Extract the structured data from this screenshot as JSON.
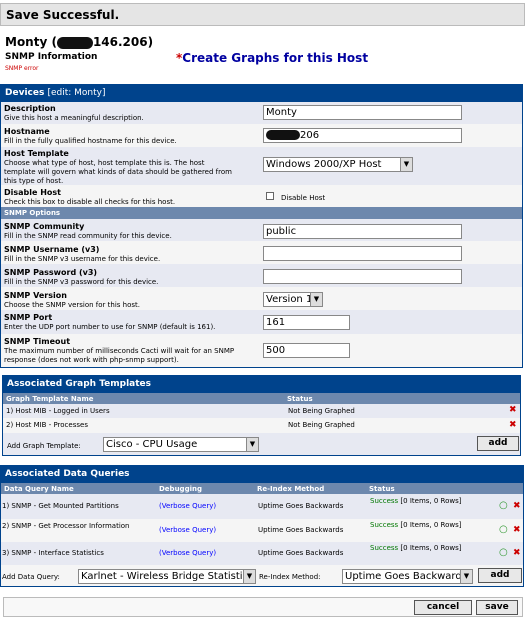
{
  "banner": {
    "message": "Save Successful."
  },
  "host": {
    "title_prefix": "Monty (",
    "title_suffix": "146.206)",
    "snmp_info": "SNMP Information",
    "snmp_error": "SNMP error"
  },
  "create_graphs": {
    "asterisk": "*",
    "label": "Create Graphs for this Host"
  },
  "devices": {
    "header": "Devices",
    "edit": "[edit: Monty]",
    "description": {
      "title": "Description",
      "help": "Give this host a meaningful description.",
      "value": "Monty"
    },
    "hostname": {
      "title": "Hostname",
      "help": "Fill in the fully qualified hostname for this device.",
      "value": "206"
    },
    "template": {
      "title": "Host Template",
      "help": "Choose what type of host, host template this is. The host template will govern what kinds of data should be gathered from this type of host.",
      "value": "Windows 2000/XP Host"
    },
    "disable": {
      "title": "Disable Host",
      "help": "Check this box to disable all checks for this host.",
      "label": "Disable Host"
    },
    "snmp_options": "SNMP Options",
    "community": {
      "title": "SNMP Community",
      "help": "Fill in the SNMP read community for this device.",
      "value": "public"
    },
    "username": {
      "title": "SNMP Username (v3)",
      "help": "Fill in the SNMP v3 username for this device.",
      "value": ""
    },
    "password": {
      "title": "SNMP Password (v3)",
      "help": "Fill in the SNMP v3 password for this device.",
      "value": ""
    },
    "version": {
      "title": "SNMP Version",
      "help": "Choose the SNMP version for this host.",
      "value": "Version 1"
    },
    "port": {
      "title": "SNMP Port",
      "help": "Enter the UDP port number to use for SNMP (default is 161).",
      "value": "161"
    },
    "timeout": {
      "title": "SNMP Timeout",
      "help": "The maximum number of milliseconds Cacti will wait for an SNMP response (does not work with php-snmp support).",
      "value": "500"
    }
  },
  "graph_templates": {
    "header": "Associated Graph Templates",
    "col_name": "Graph Template Name",
    "col_status": "Status",
    "rows": [
      {
        "name": "1) Host MIB - Logged in Users",
        "status": "Not Being Graphed"
      },
      {
        "name": "2) Host MIB - Processes",
        "status": "Not Being Graphed"
      }
    ],
    "add_label": "Add Graph Template:",
    "add_value": "Cisco - CPU Usage",
    "add_button": "add"
  },
  "data_queries": {
    "header": "Associated Data Queries",
    "col_name": "Data Query Name",
    "col_debug": "Debugging",
    "col_reindex": "Re-Index Method",
    "col_status": "Status",
    "rows": [
      {
        "name": "1) SNMP - Get Mounted Partitions",
        "debug": "(Verbose Query)",
        "reindex": "Uptime Goes Backwards",
        "status_word": "Success",
        "status_rest": "[0 Items, 0 Rows]"
      },
      {
        "name": "2) SNMP - Get Processor Information",
        "debug": "(Verbose Query)",
        "reindex": "Uptime Goes Backwards",
        "status_word": "Success",
        "status_rest": "[0 Items, 0 Rows]"
      },
      {
        "name": "3) SNMP - Interface Statistics",
        "debug": "(Verbose Query)",
        "reindex": "Uptime Goes Backwards",
        "status_word": "Success",
        "status_rest": "[0 Items, 0 Rows]"
      }
    ],
    "add_label": "Add Data Query:",
    "add_value": "Karlnet - Wireless Bridge Statistics",
    "reindex_label": "Re-Index Method:",
    "reindex_value": "Uptime Goes Backwards",
    "add_button": "add"
  },
  "footer": {
    "cancel": "cancel",
    "save": "save"
  },
  "icons": {
    "delete": "delete-x-icon",
    "reload": "reload-circle-icon",
    "dropdown": "dropdown-arrow-icon"
  },
  "colors": {
    "header": "#00438c",
    "subheader": "#6d88ad",
    "row_alt": "#e7e9f2",
    "row": "#f5f5f5",
    "banner": "#e5e5e5"
  }
}
